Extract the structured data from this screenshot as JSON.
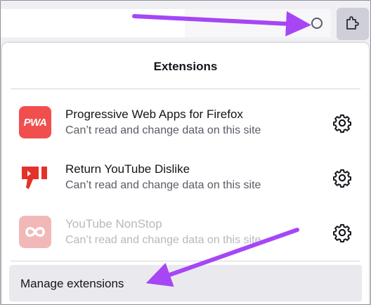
{
  "panel": {
    "title": "Extensions"
  },
  "extensions": [
    {
      "name": "Progressive Web Apps for Firefox",
      "status": "Can’t read and change data on this site",
      "logo_text": "PWA",
      "logo_color": "#f14e4e",
      "icon": "pwa-logo-icon",
      "enabled": true
    },
    {
      "name": "Return YouTube Dislike",
      "status": "Can’t read and change data on this site",
      "icon": "thumbs-down-logo-icon",
      "logo_color": "#e4322b",
      "enabled": true
    },
    {
      "name": "YouTube NonStop",
      "status": "Can’t read and change data on this site",
      "icon": "infinity-logo-icon",
      "logo_color": "#f2b8b8",
      "enabled": false
    }
  ],
  "footer": {
    "manage_label": "Manage extensions"
  },
  "colors": {
    "annotation_arrow": "#a646f5"
  }
}
